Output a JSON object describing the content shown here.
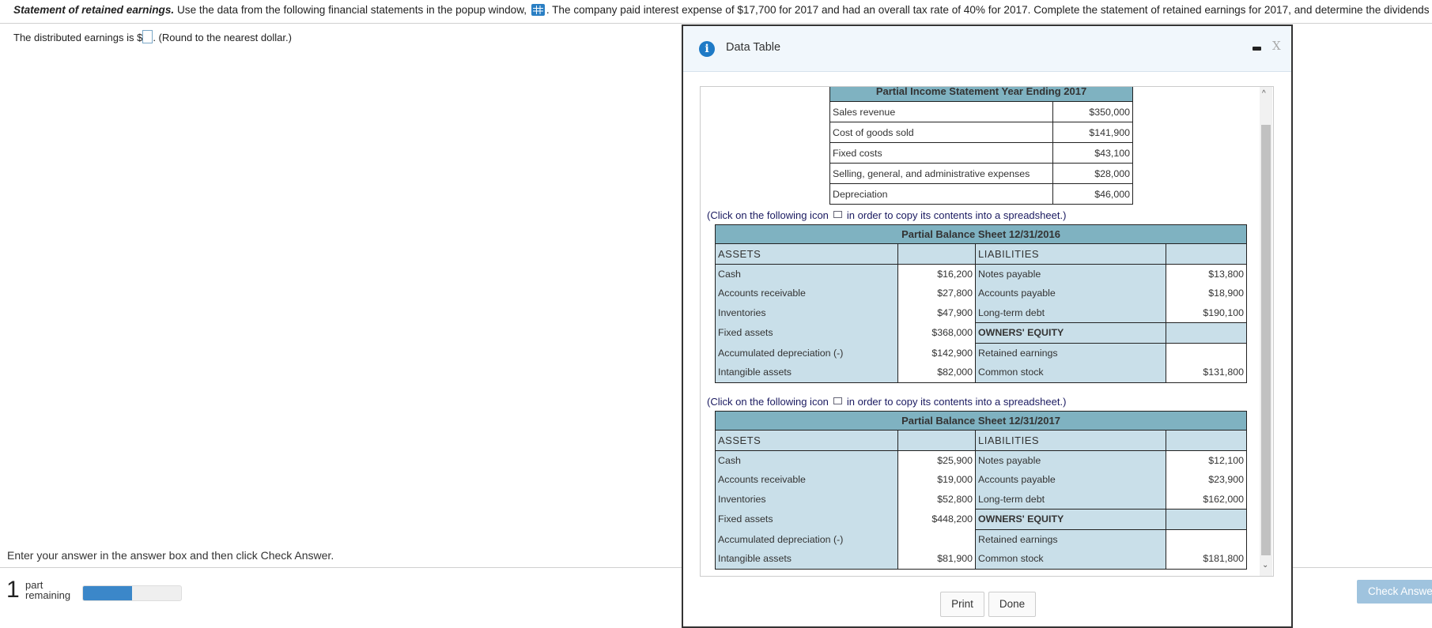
{
  "question": {
    "title": "Statement of retained earnings.",
    "text_before_icon": " Use the data from the following financial statements in the popup window, ",
    "icon": "data-table-grid-icon",
    "text_after_icon": ". The company paid interest expense of $17,700 for 2017 and had an overall tax rate of 40% for 2017. Complete the statement of retained earnings for 2017, and determine the dividends paid last year."
  },
  "answer": {
    "prefix": "The distributed earnings is $",
    "value": "",
    "suffix": ". (Round to the nearest dollar.)"
  },
  "footer": {
    "instruction": "Enter your answer in the answer box and then click Check Answer.",
    "parts_count": "1",
    "parts_label_1": "part",
    "parts_label_2": "remaining",
    "progress_percent": 50,
    "check_answer": "Check Answer"
  },
  "modal": {
    "title": "Data Table",
    "minimize_icon": "minimize-icon",
    "close_label": "X",
    "print": "Print",
    "done": "Done",
    "income_statement": {
      "title": "Partial Income Statement Year Ending 2017",
      "rows": [
        {
          "label": "Sales revenue",
          "value": "$350,000"
        },
        {
          "label": "Cost of goods sold",
          "value": "$141,900"
        },
        {
          "label": "Fixed costs",
          "value": "$43,100"
        },
        {
          "label": "Selling, general, and administrative expenses",
          "value": "$28,000"
        },
        {
          "label": "Depreciation",
          "value": "$46,000"
        }
      ]
    },
    "copy_text_before": "(Click on the following icon",
    "copy_text_after": "in order to copy its contents into a spreadsheet.)",
    "balance_sheets": [
      {
        "title": "Partial Balance Sheet 12/31/2016",
        "assets_header": "ASSETS",
        "liabilities_header": "LIABILITIES",
        "equity_header": "OWNERS' EQUITY",
        "rows": [
          [
            "Cash",
            "$16,200",
            "Notes payable",
            "$13,800"
          ],
          [
            "Accounts receivable",
            "$27,800",
            "Accounts payable",
            "$18,900"
          ],
          [
            "Inventories",
            "$47,900",
            "Long-term debt",
            "$190,100"
          ],
          [
            "Fixed assets",
            "$368,000",
            "OWNERS' EQUITY",
            ""
          ],
          [
            "Accumulated depreciation (-)",
            "$142,900",
            "Retained earnings",
            ""
          ],
          [
            "Intangible assets",
            "$82,000",
            "Common stock",
            "$131,800"
          ]
        ]
      },
      {
        "title": "Partial Balance Sheet 12/31/2017",
        "assets_header": "ASSETS",
        "liabilities_header": "LIABILITIES",
        "equity_header": "OWNERS' EQUITY",
        "rows": [
          [
            "Cash",
            "$25,900",
            "Notes payable",
            "$12,100"
          ],
          [
            "Accounts receivable",
            "$19,000",
            "Accounts payable",
            "$23,900"
          ],
          [
            "Inventories",
            "$52,800",
            "Long-term debt",
            "$162,000"
          ],
          [
            "Fixed assets",
            "$448,200",
            "OWNERS' EQUITY",
            ""
          ],
          [
            "Accumulated depreciation (-)",
            "",
            "Retained earnings",
            ""
          ],
          [
            "Intangible assets",
            "$81,900",
            "Common stock",
            "$181,800"
          ]
        ]
      }
    ]
  }
}
